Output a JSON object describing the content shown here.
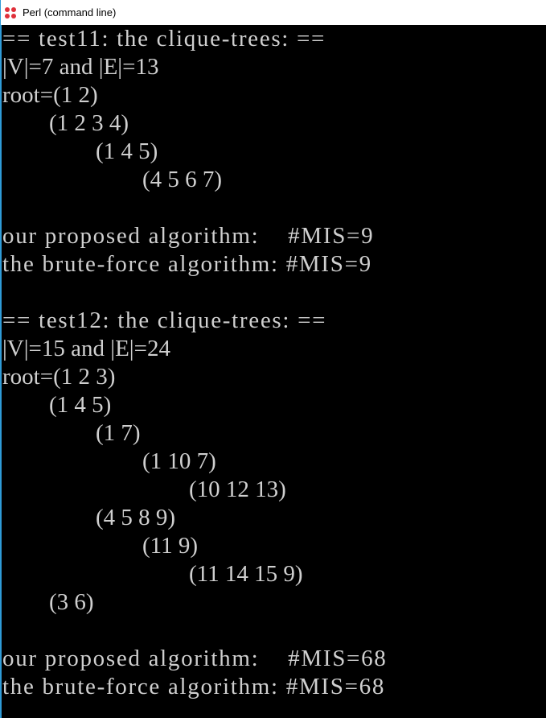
{
  "window": {
    "title": "Perl (command line)"
  },
  "colors": {
    "console_bg": "#000000",
    "console_text": "#cfcfcf",
    "titlebar_bg": "#ffffff",
    "app_icon_red": "#e0303a",
    "window_border_blue": "#2f9bd7"
  },
  "icons": {
    "app_icon": "perl-icon"
  },
  "console": {
    "lines": [
      "== test11: the clique-trees: ==",
      "|V|=7 and |E|=13",
      "root=(1 2)",
      "        (1 2 3 4)",
      "                (1 4 5)",
      "                        (4 5 6 7)",
      "",
      "our proposed algorithm:    #MIS=9",
      "the brute-force algorithm: #MIS=9",
      "",
      "== test12: the clique-trees: ==",
      "|V|=15 and |E|=24",
      "root=(1 2 3)",
      "        (1 4 5)",
      "                (1 7)",
      "                        (1 10 7)",
      "                                (10 12 13)",
      "                (4 5 8 9)",
      "                        (11 9)",
      "                                (11 14 15 9)",
      "        (3 6)",
      "",
      "our proposed algorithm:    #MIS=68",
      "the brute-force algorithm: #MIS=68"
    ]
  }
}
